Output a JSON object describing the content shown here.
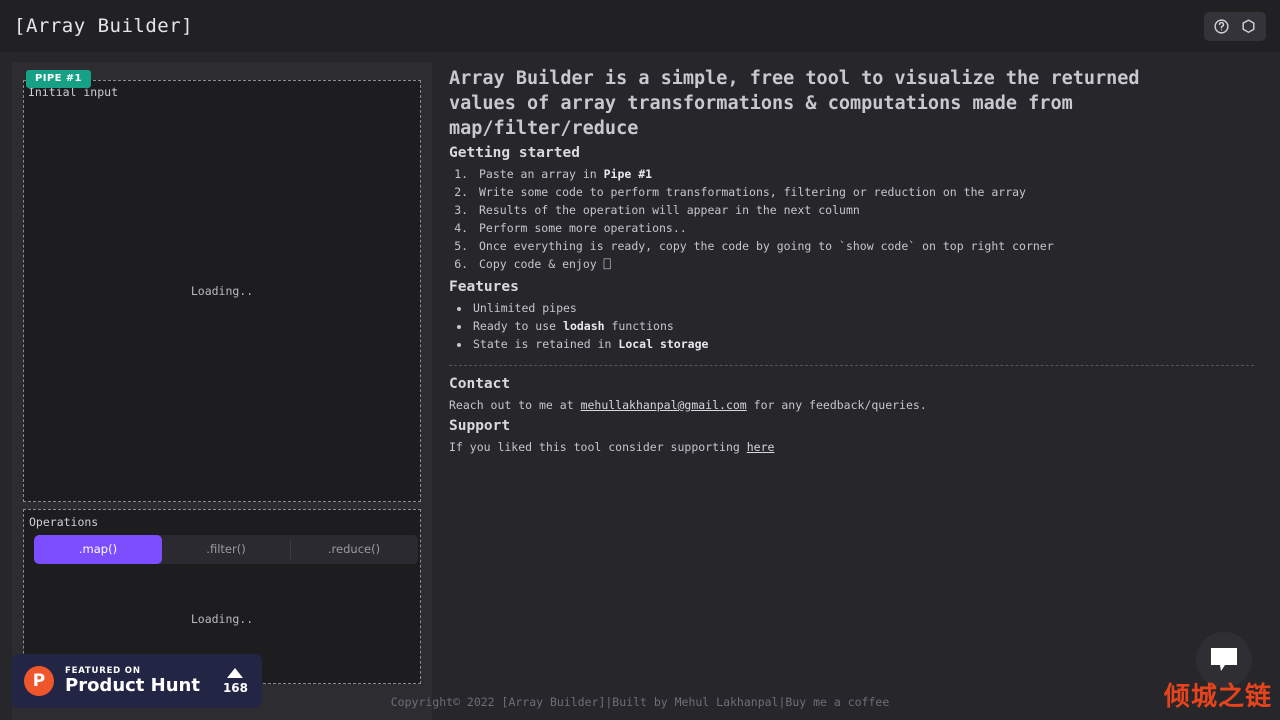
{
  "header": {
    "title": "[Array Builder]",
    "help_icon": "question-circle-icon",
    "theme_icon": "hexagon-icon"
  },
  "pipe": {
    "badge": "PIPE #1",
    "input_label": "Initial input",
    "input_loading": "Loading..",
    "operations_label": "Operations",
    "tabs": [
      {
        "label": ".map()",
        "active": true
      },
      {
        "label": ".filter()",
        "active": false
      },
      {
        "label": ".reduce()",
        "active": false
      }
    ],
    "output_loading": "Loading.."
  },
  "content": {
    "intro": "Array Builder is a simple, free tool to visualize the returned values of array transformations & computations made from map/filter/reduce",
    "getting_started_title": "Getting started",
    "steps": [
      {
        "pre": "Paste an array in ",
        "strong": "Pipe #1",
        "post": ""
      },
      {
        "pre": "Write some code to perform transformations, filtering or reduction on the array",
        "strong": "",
        "post": ""
      },
      {
        "pre": "Results of the operation will appear in the next column",
        "strong": "",
        "post": ""
      },
      {
        "pre": "Perform some more operations..",
        "strong": "",
        "post": ""
      },
      {
        "pre": "Once everything is ready, copy the code by going to `show code` on top right corner",
        "strong": "",
        "post": ""
      },
      {
        "pre": "Copy code & enjoy ⎕",
        "strong": "",
        "post": ""
      }
    ],
    "features_title": "Features",
    "features": [
      {
        "pre": "Unlimited pipes",
        "strong": "",
        "post": ""
      },
      {
        "pre": "Ready to use ",
        "strong": "lodash",
        "post": " functions"
      },
      {
        "pre": "State is retained in ",
        "strong": "Local storage",
        "post": ""
      }
    ],
    "contact_title": "Contact",
    "contact_pre": "Reach out to me at ",
    "contact_email": "mehullakhanpal@gmail.com",
    "contact_post": " for any feedback/queries.",
    "support_title": "Support",
    "support_pre": "If you liked this tool consider supporting ",
    "support_link": "here"
  },
  "product_hunt": {
    "kicker": "FEATURED ON",
    "name": "Product Hunt",
    "logo_letter": "P",
    "votes": "168"
  },
  "footer": {
    "text": "Copyright© 2022 [Array Builder]|Built by Mehul Lakhanpal|Buy me a coffee"
  },
  "chat": {
    "icon": "chat-bubble-icon"
  },
  "watermark": {
    "text": "倾城之链"
  },
  "colors": {
    "accent_purple": "#7c4dff",
    "pipe_green": "#16a085",
    "product_hunt_orange": "#f0562b",
    "background": "#26262b",
    "panel": "#2c2c31",
    "watermark_red": "#e8441c"
  }
}
